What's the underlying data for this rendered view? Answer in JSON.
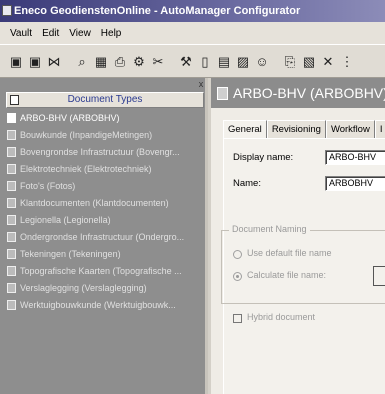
{
  "window": {
    "title": "Eneco GeodienstenOnline - AutoManager Configurator"
  },
  "menu": [
    "Vault",
    "Edit",
    "View",
    "Help"
  ],
  "toolbar": {
    "icons": [
      "save-icon",
      "save-all-icon",
      "connect-icon",
      "print-preview-icon",
      "grid-icon",
      "print-icon",
      "settings-icon",
      "cut-icon",
      "tool-icon",
      "new-document-icon",
      "document-type-icon",
      "properties-icon",
      "user-icon",
      "copy-icon",
      "paste-icon",
      "delete-icon",
      "more-icon"
    ],
    "glyphs": [
      "▣",
      "▣",
      "⋈",
      "⌕",
      "▦",
      "⎙",
      "⚙",
      "✂",
      "⚒",
      "▯",
      "▤",
      "▨",
      "☺",
      "⎘",
      "▧",
      "✕",
      "⋮"
    ]
  },
  "left_panel": {
    "close_glyph": "x",
    "header": "Document Types",
    "items": [
      "ARBO-BHV (ARBOBHV)",
      "Bouwkunde (InpandigeMetingen)",
      "Bovengrondse Infrastructuur (Bovengr...",
      "Elektrotechniek (Elektrotechniek)",
      "Foto's (Fotos)",
      "Klantdocumenten (Klantdocumenten)",
      "Legionella (Legionella)",
      "Ondergrondse Infrastructuur (Ondergro...",
      "Tekeningen (Tekeningen)",
      "Topografische Kaarten (Topografische ...",
      "Verslaglegging (Verslaglegging)",
      "Werktuigbouwkunde (Werktuigbouwk..."
    ],
    "selected_index": 0
  },
  "right_panel": {
    "header": "ARBO-BHV (ARBOBHV)",
    "tabs": [
      "General",
      "Revisioning",
      "Workflow",
      "I"
    ],
    "active_tab": 0,
    "display_name_label": "Display name:",
    "display_name_value": "ARBO-BHV",
    "name_label": "Name:",
    "name_value": "ARBOBHV",
    "document_naming": {
      "title": "Document Naming",
      "option_default": "Use default file name",
      "option_calculate": "Calculate file name:",
      "selected": "calculate"
    },
    "hybrid_document_label": "Hybrid document"
  }
}
